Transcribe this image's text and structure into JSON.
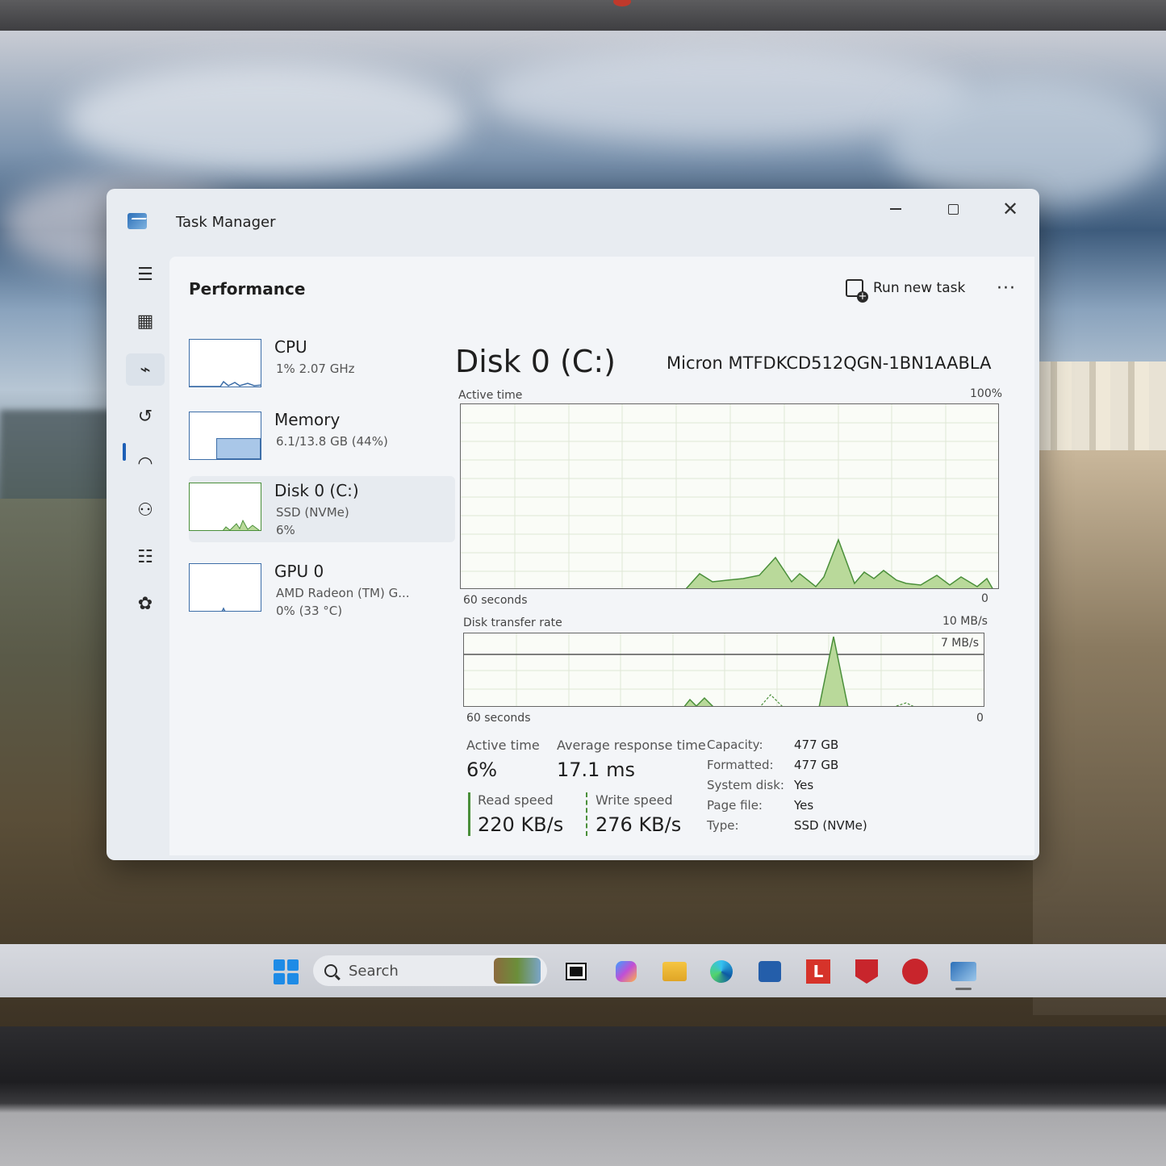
{
  "window": {
    "title": "Task Manager"
  },
  "header": {
    "page_title": "Performance",
    "run_new_task": "Run new task",
    "more_glyph": "···"
  },
  "nav": {
    "icons": [
      "hamburger-icon",
      "processes-icon",
      "performance-icon",
      "app-history-icon",
      "startup-icon",
      "users-icon",
      "details-icon",
      "services-icon",
      "settings-icon"
    ],
    "active": "performance"
  },
  "devices": [
    {
      "name": "CPU",
      "sub1": "1%  2.07 GHz",
      "sub2": "",
      "sub3": ""
    },
    {
      "name": "Memory",
      "sub1": "6.1/13.8 GB (44%)",
      "sub2": "",
      "sub3": ""
    },
    {
      "name": "Disk 0 (C:)",
      "sub1": "SSD (NVMe)",
      "sub2": "6%",
      "sub3": ""
    },
    {
      "name": "GPU 0",
      "sub1": "AMD Radeon (TM) G...",
      "sub2": "0%  (33 °C)",
      "sub3": ""
    }
  ],
  "detail": {
    "title": "Disk 0 (C:)",
    "model": "Micron MTFDKCD512QGN-1BN1AABLA",
    "graph1": {
      "label": "Active time",
      "max": "100%",
      "xleft": "60 seconds",
      "xright": "0"
    },
    "graph2": {
      "label": "Disk transfer rate",
      "max": "10 MB/s",
      "line": "7 MB/s",
      "xleft": "60 seconds",
      "xright": "0"
    },
    "stats": {
      "active_time_label": "Active time",
      "active_time_value": "6%",
      "avg_resp_label": "Average response time",
      "avg_resp_value": "17.1 ms",
      "read_label": "Read speed",
      "read_value": "220 KB/s",
      "write_label": "Write speed",
      "write_value": "276 KB/s"
    },
    "props": [
      {
        "label": "Capacity:",
        "value": "477 GB"
      },
      {
        "label": "Formatted:",
        "value": "477 GB"
      },
      {
        "label": "System disk:",
        "value": "Yes"
      },
      {
        "label": "Page file:",
        "value": "Yes"
      },
      {
        "label": "Type:",
        "value": "SSD (NVMe)"
      }
    ]
  },
  "taskbar": {
    "search_placeholder": "Search",
    "apps": [
      "start-icon",
      "task-view-icon",
      "copilot-icon",
      "file-explorer-icon",
      "edge-icon",
      "store-icon",
      "lenovo-app-icon",
      "mcafee-icon",
      "clipboard-app-icon",
      "task-manager-icon"
    ]
  },
  "colors": {
    "graph_fill": "#b9d99a",
    "graph_stroke": "#4a8f3a",
    "accent": "#1d5fb6"
  }
}
